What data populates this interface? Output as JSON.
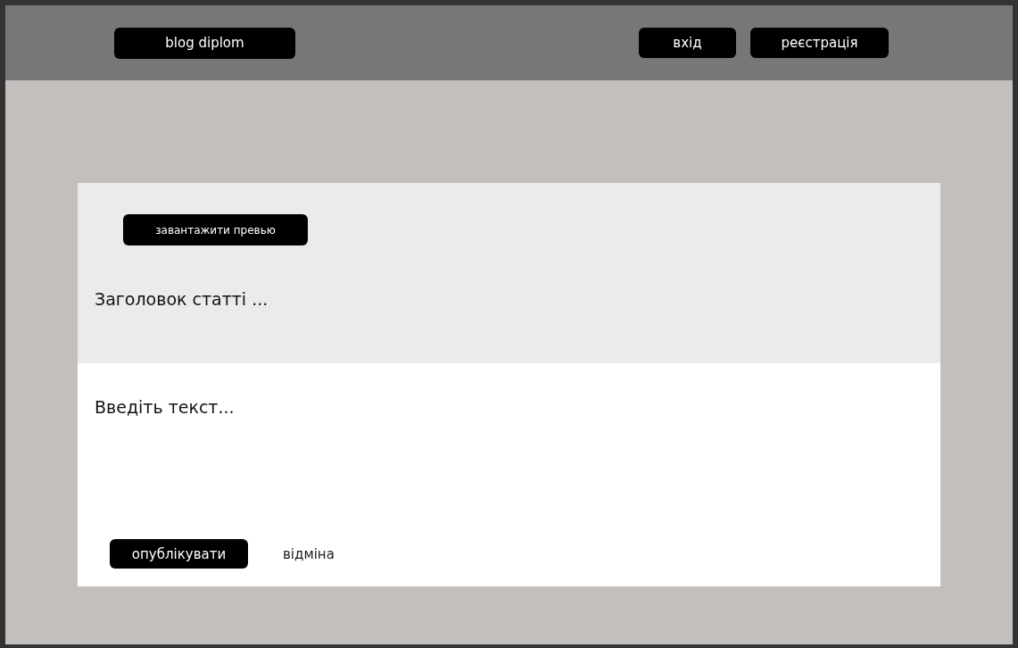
{
  "header": {
    "logo": "blog diplom",
    "buttons": [
      "вхід",
      "реєстрація"
    ]
  },
  "editor": {
    "upload_button": "завантажити превью",
    "title_field": {
      "placeholder": "Заголовок статті ..."
    },
    "body_field": {
      "placeholder": "Введіть текст..."
    },
    "publish_button": "опублікувати",
    "cancel_link": "відміна"
  }
}
